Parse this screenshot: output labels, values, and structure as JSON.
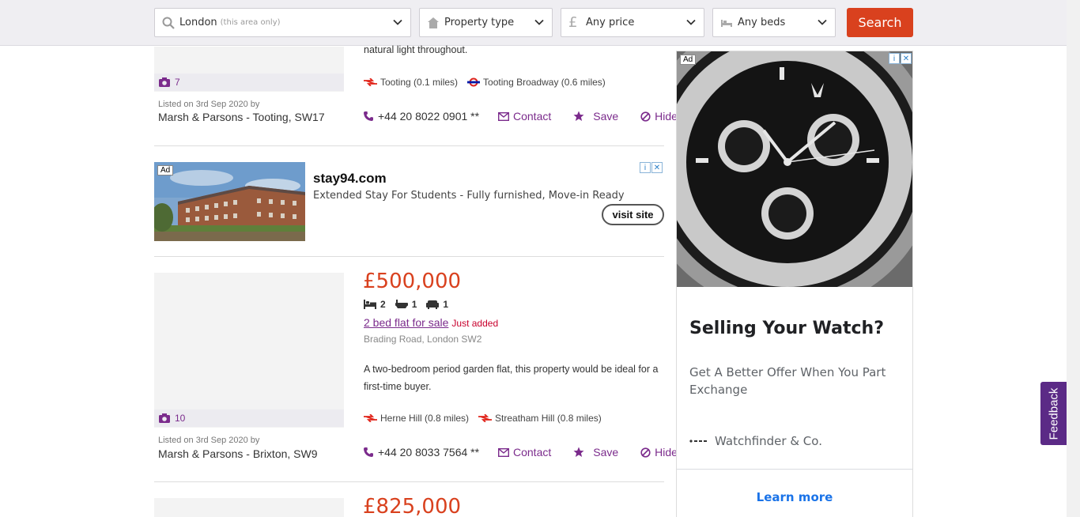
{
  "search": {
    "location": "London",
    "location_hint": "(this area only)",
    "property_type": "Property type",
    "price": "Any price",
    "beds": "Any beds",
    "button": "Search"
  },
  "listing_top": {
    "desc_tail": "natural light throughout.",
    "photo_count": "7",
    "stations": [
      {
        "name": "Tooting (0.1 miles)",
        "type": "rail"
      },
      {
        "name": "Tooting Broadway (0.6 miles)",
        "type": "underground"
      }
    ],
    "listed": "Listed on 3rd Sep 2020 by",
    "agent": "Marsh & Parsons - Tooting, SW17",
    "phone": "+44 20 8022 0901 **",
    "contact": "Contact",
    "save": "Save",
    "hide": "Hide"
  },
  "inline_ad": {
    "tag": "Ad",
    "title": "stay94.com",
    "subtitle": "Extended Stay For Students - Fully furnished, Move-in Ready",
    "cta": "visit site"
  },
  "listing_2": {
    "price": "£500,000",
    "beds": "2",
    "baths": "1",
    "receptions": "1",
    "title": "2 bed flat for sale",
    "badge": "Just added",
    "address": "Brading Road, London SW2",
    "description": "A two-bedroom period garden flat, this property would be ideal for a first-time buyer.",
    "photo_count": "10",
    "stations": [
      {
        "name": "Herne Hill (0.8 miles)",
        "type": "rail"
      },
      {
        "name": "Streatham Hill (0.8 miles)",
        "type": "rail"
      }
    ],
    "listed": "Listed on 3rd Sep 2020 by",
    "agent": "Marsh & Parsons - Brixton, SW9",
    "phone": "+44 20 8033 7564 **",
    "contact": "Contact",
    "save": "Save",
    "hide": "Hide"
  },
  "listing_3": {
    "price": "£825,000"
  },
  "side_ad": {
    "tag": "Ad",
    "heading": "Selling Your Watch?",
    "text": "Get A Better Offer When You Part Exchange",
    "brand": "Watchfinder & Co.",
    "cta": "Learn more"
  },
  "feedback": "Feedback",
  "colors": {
    "accent": "#d9411e",
    "purple": "#7b2b8c",
    "feedback_bg": "#5b2a86",
    "link_blue": "#1a73e8"
  }
}
